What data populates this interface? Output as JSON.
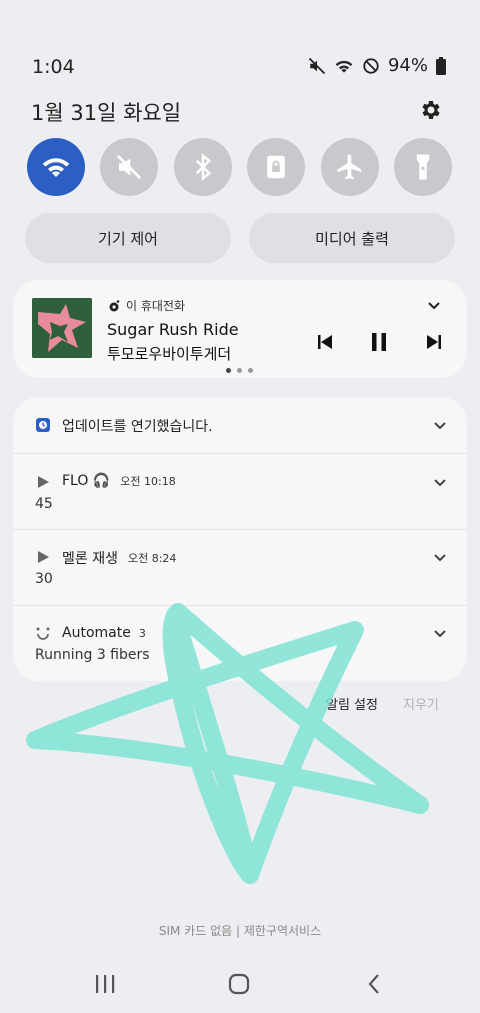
{
  "status_bar": {
    "time": "1:04",
    "battery": "94%"
  },
  "date": "1월 31일 화요일",
  "quick_toggles": [
    {
      "name": "wifi",
      "icon": "wifi-icon",
      "active": true
    },
    {
      "name": "sound-off",
      "icon": "mute-icon",
      "active": false
    },
    {
      "name": "bluetooth",
      "icon": "bluetooth-icon",
      "active": false
    },
    {
      "name": "lock",
      "icon": "portrait-lock-icon",
      "active": false
    },
    {
      "name": "airplane",
      "icon": "airplane-icon",
      "active": false
    },
    {
      "name": "flashlight",
      "icon": "flashlight-icon",
      "active": false
    }
  ],
  "pills": {
    "device_control": "기기 제어",
    "media_output": "미디어 출력"
  },
  "media": {
    "source": "이 휴대전화",
    "title": "Sugar Rush Ride",
    "artist": "투모로우바이투게더"
  },
  "notifications": [
    {
      "title": "업데이트를 연기했습니다.",
      "time": "",
      "count": "",
      "sub": ""
    },
    {
      "title": "FLO 🎧",
      "time": "오전 10:18",
      "count": "",
      "sub": "45"
    },
    {
      "title": "멜론 재생",
      "time": "오전 8:24",
      "count": "",
      "sub": "30"
    },
    {
      "title": "Automate",
      "time": "",
      "count": "3",
      "sub": "Running 3 fibers"
    }
  ],
  "actions": {
    "notification_settings": "알림 설정",
    "clear": "지우기"
  },
  "carrier": "SIM 카드 없음 | 제한구역서비스",
  "colors": {
    "accent": "#2c5fc3",
    "scribble": "#7fe3d3"
  }
}
